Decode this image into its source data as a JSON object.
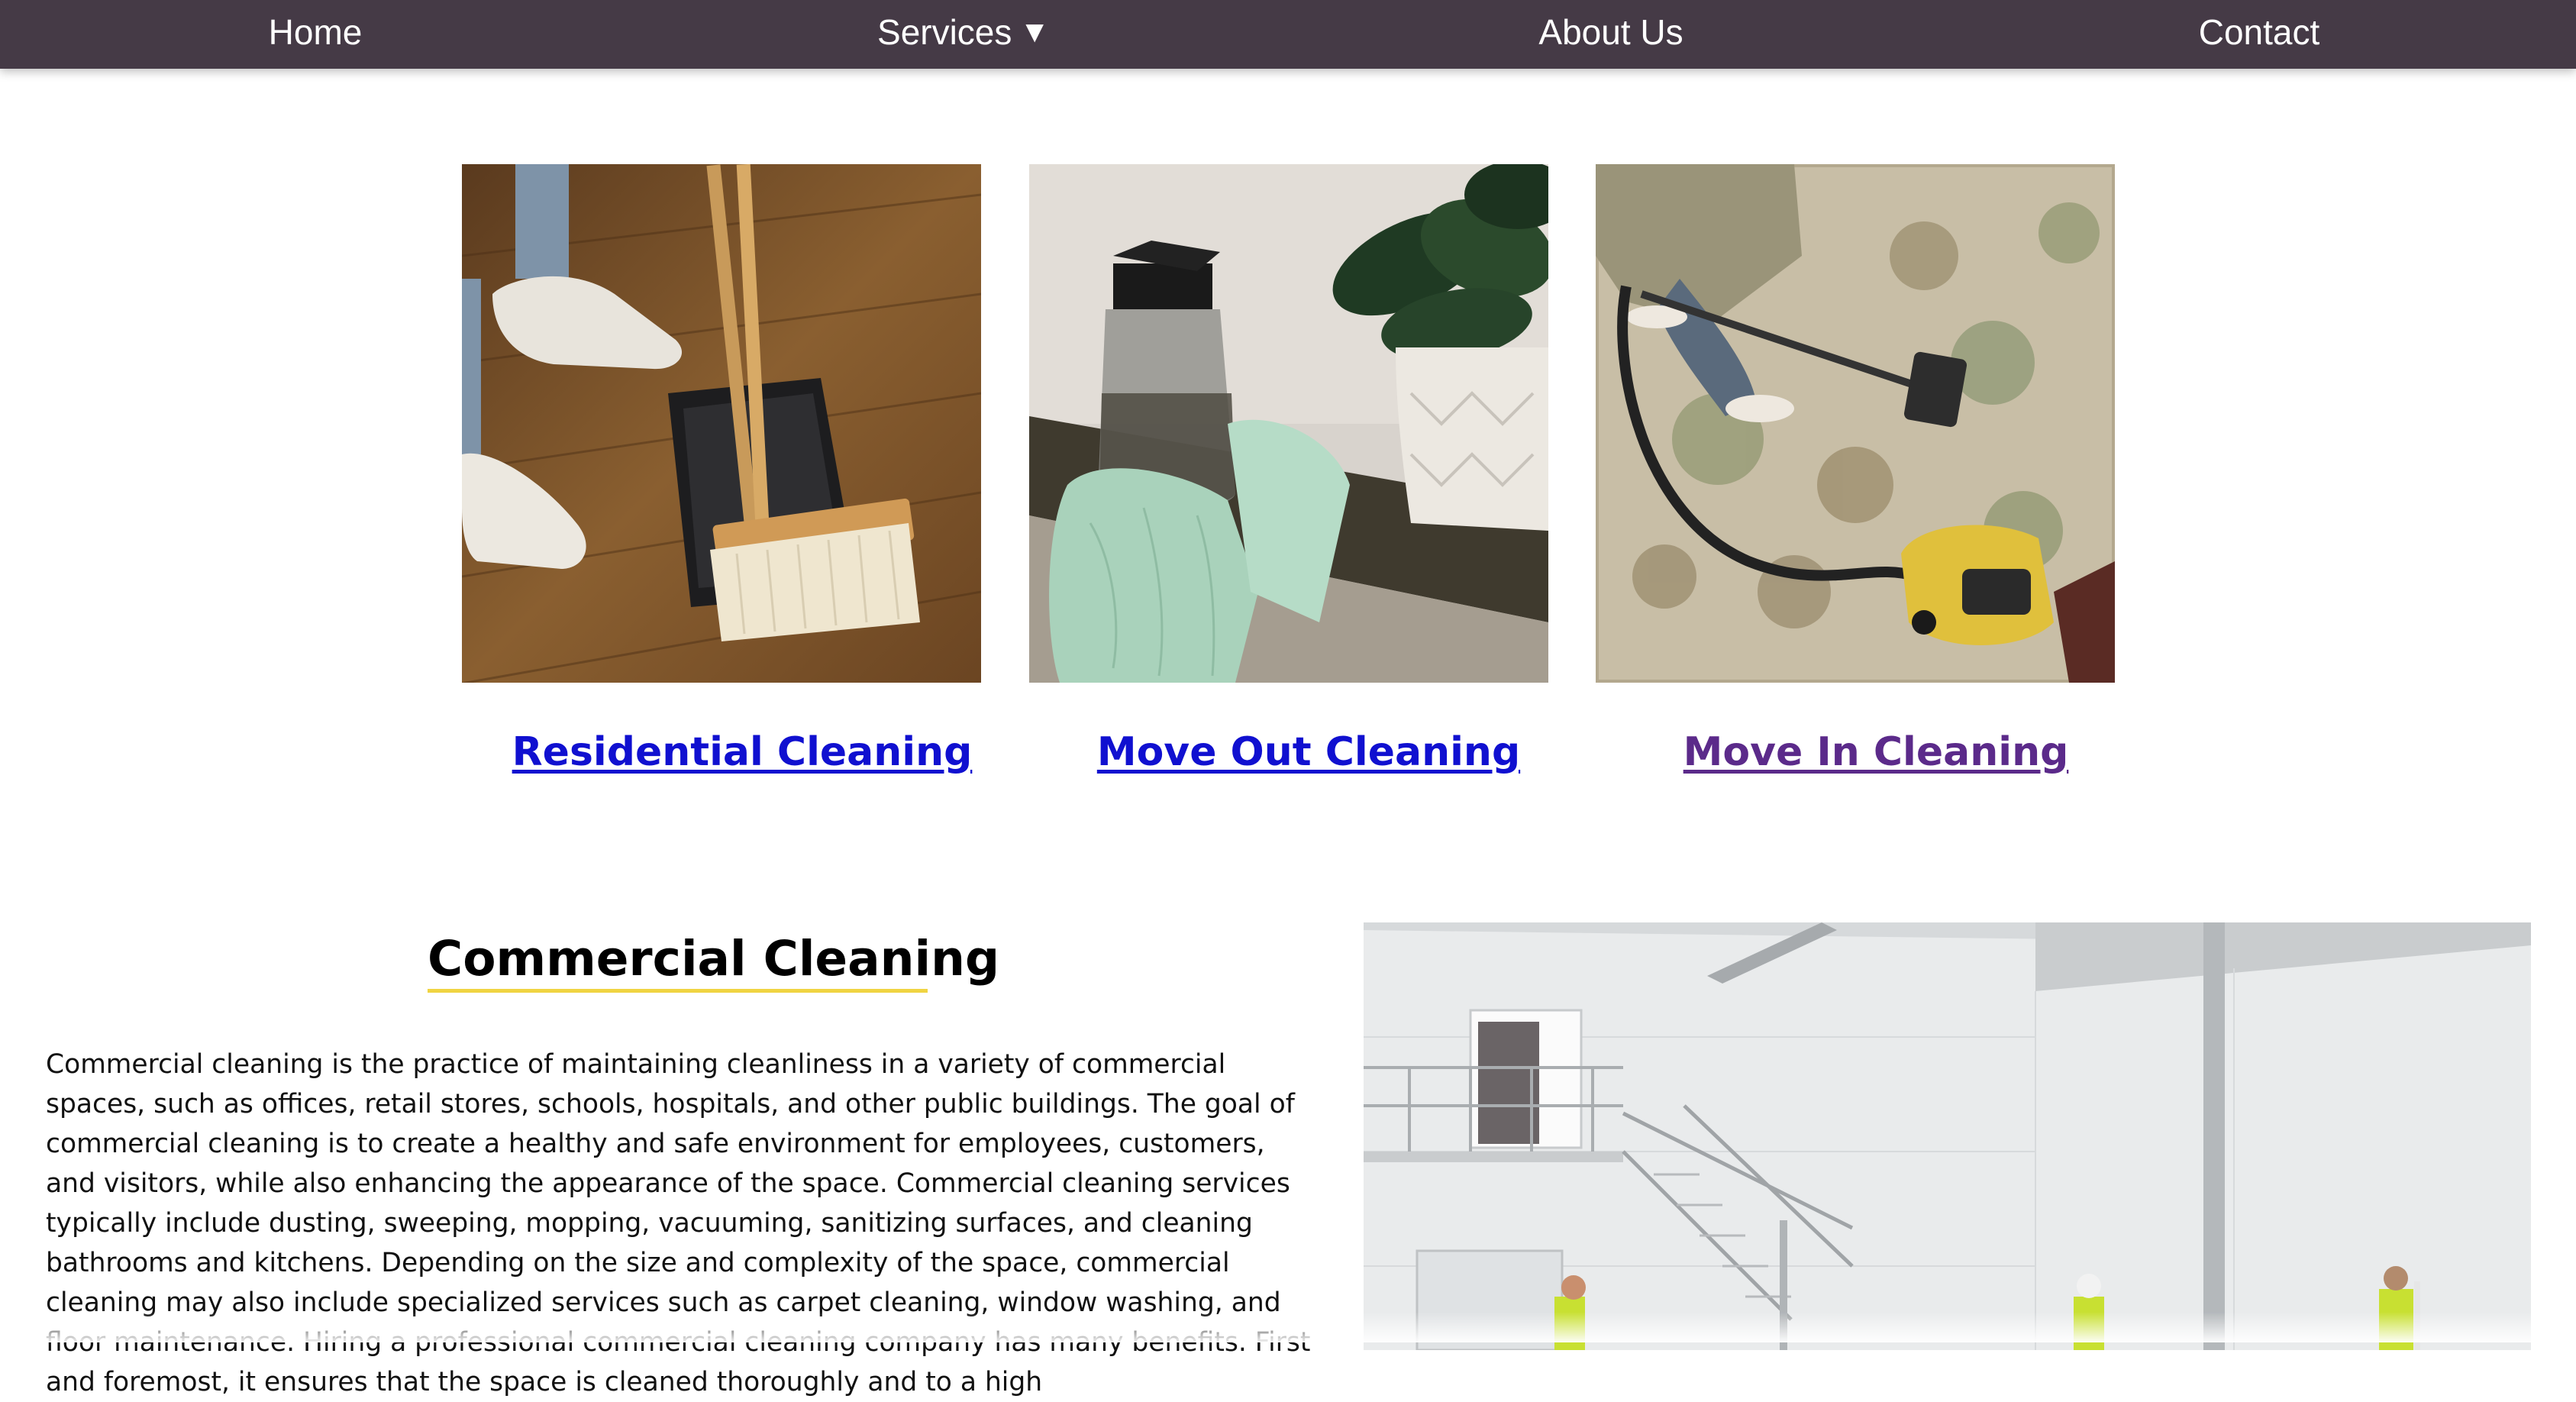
{
  "nav": {
    "items": [
      {
        "label": "Home"
      },
      {
        "label": "Services",
        "caret": "▼"
      },
      {
        "label": "About Us"
      },
      {
        "label": "Contact"
      }
    ]
  },
  "services": [
    {
      "label": "Residential Cleaning",
      "image": "broom-and-dustpan-photo",
      "link_color": "#1010d0"
    },
    {
      "label": "Move Out Cleaning",
      "image": "spray-bottle-and-gloves-photo",
      "link_color": "#1010d0"
    },
    {
      "label": "Move In Cleaning",
      "image": "vacuum-on-carpet-photo",
      "link_color": "#5b2a8a"
    }
  ],
  "commercial": {
    "title": "Commercial Cleaning",
    "accent": "#f0d442",
    "paragraph": "Commercial cleaning is the practice of maintaining cleanliness in a variety of commercial spaces, such as offices, retail stores, schools, hospitals, and other public buildings. The goal of commercial cleaning is to create a healthy and safe environment for employees, customers, and visitors, while also enhancing the appearance of the space. Commercial cleaning services typically include dusting, sweeping, mopping, vacuuming, sanitizing surfaces, and cleaning bathrooms and kitchens. Depending on the size and complexity of the space, commercial cleaning may also include specialized services such as carpet cleaning, window washing, and floor maintenance. Hiring a professional commercial cleaning company has many benefits. First and foremost, it ensures that the space is cleaned thoroughly and to a high",
    "image": "warehouse-workers-photo"
  },
  "colors": {
    "nav_bg": "#453a46",
    "link_unvisited": "#1010d0",
    "link_visited": "#5b2a8a"
  }
}
